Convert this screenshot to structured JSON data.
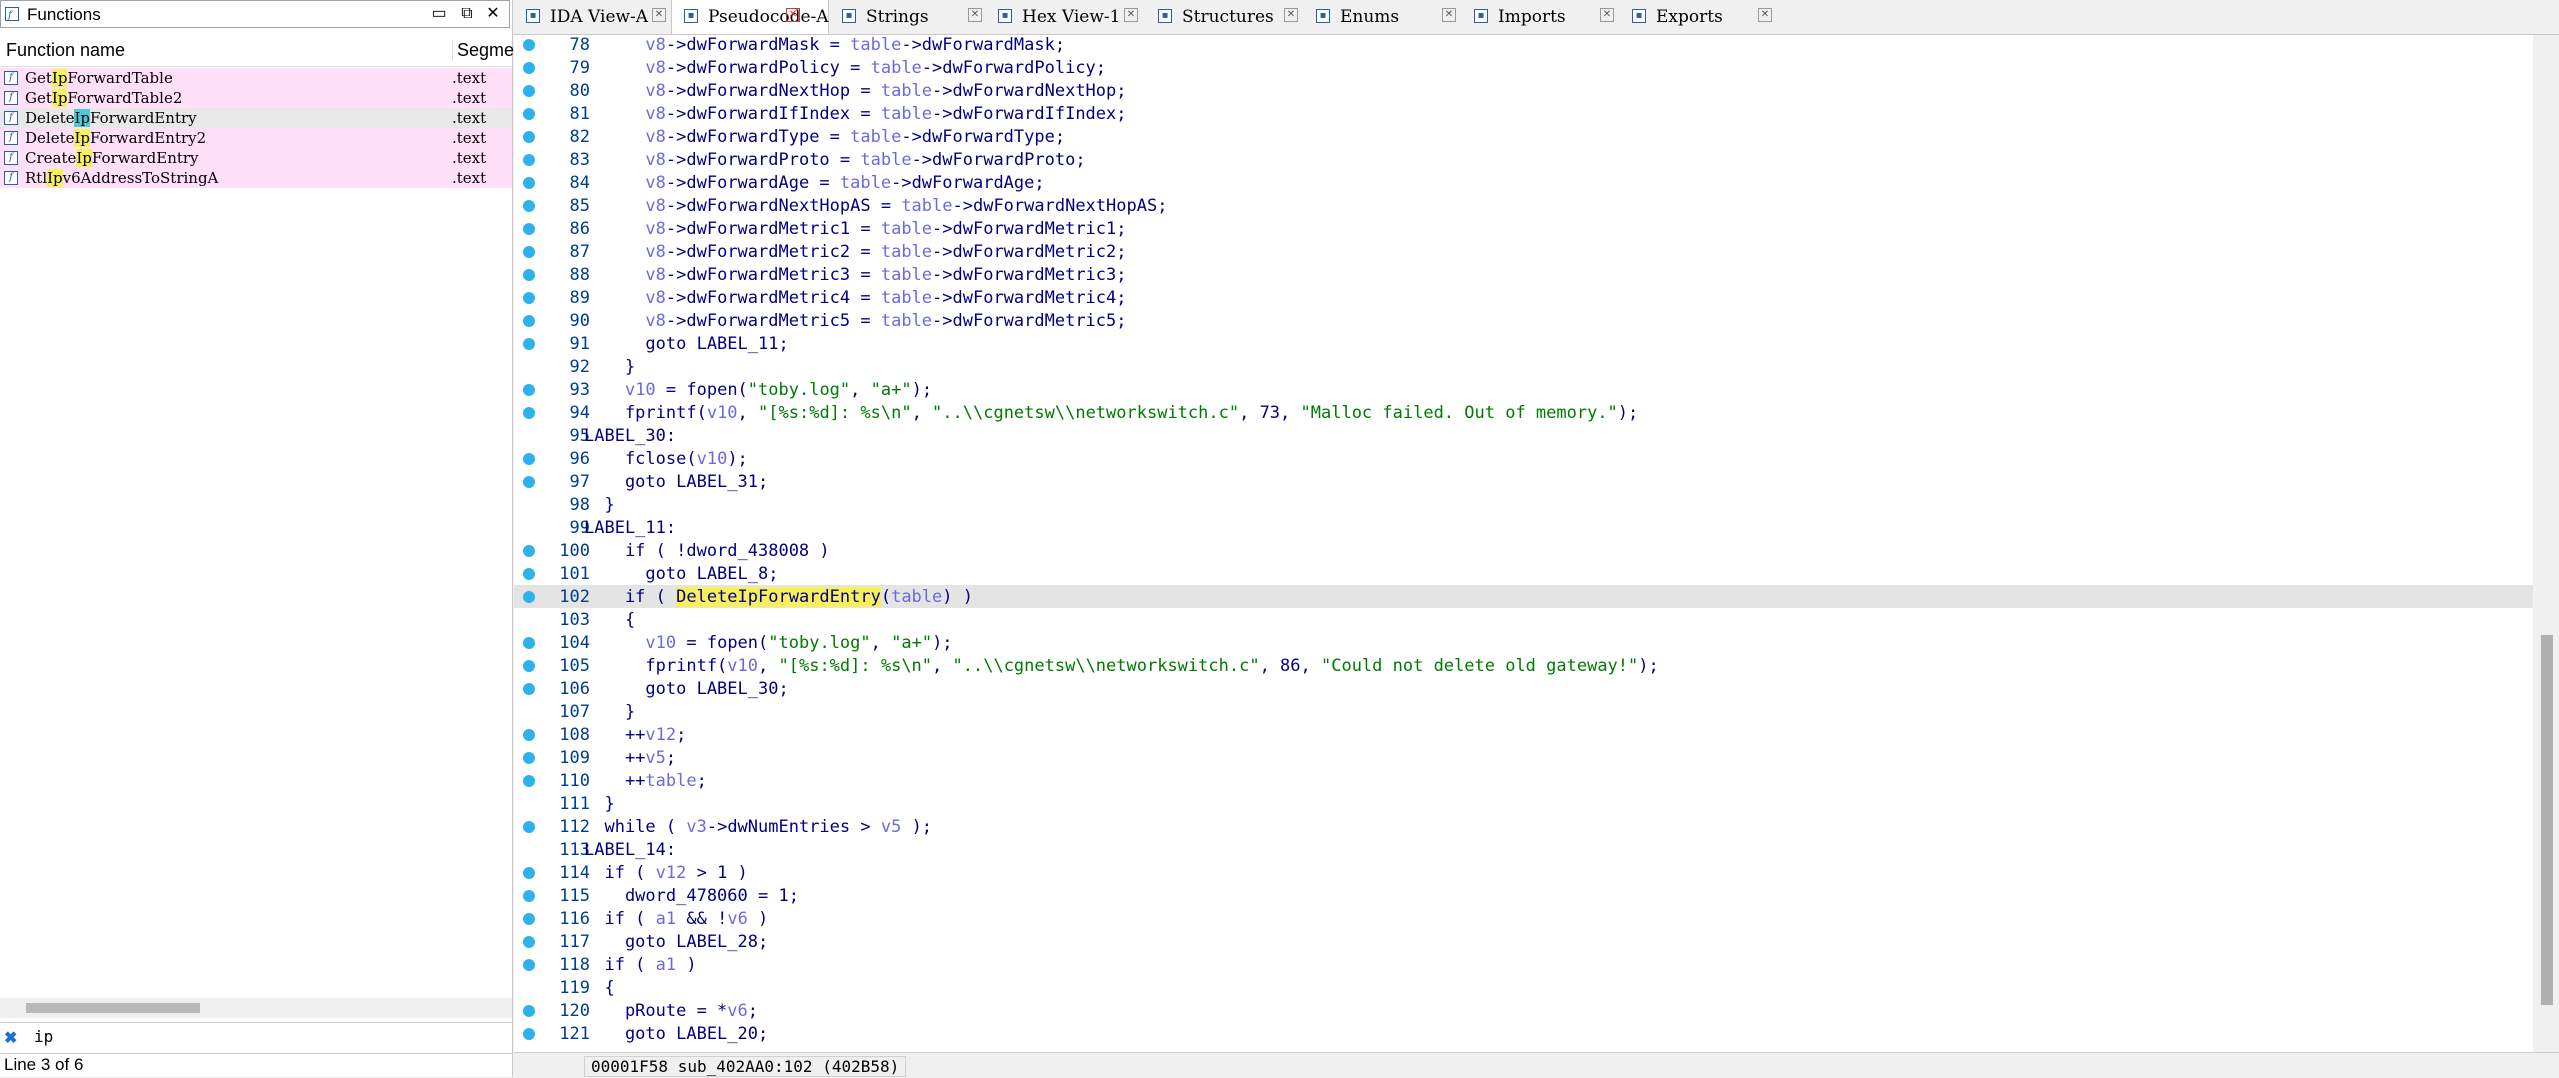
{
  "functions_pane": {
    "title": "Functions",
    "col_name": "Function name",
    "col_segment": "Segme",
    "rows": [
      {
        "pre": "Get",
        "hl": "Ip",
        "post": "ForwardTable",
        "seg": ".text",
        "selected": false
      },
      {
        "pre": "Get",
        "hl": "Ip",
        "post": "ForwardTable2",
        "seg": ".text",
        "selected": false
      },
      {
        "pre": "Delete",
        "hl": "Ip",
        "post": "ForwardEntry",
        "seg": ".text",
        "selected": true
      },
      {
        "pre": "Delete",
        "hl": "Ip",
        "post": "ForwardEntry2",
        "seg": ".text",
        "selected": false
      },
      {
        "pre": "Create",
        "hl": "Ip",
        "post": "ForwardEntry",
        "seg": ".text",
        "selected": false
      },
      {
        "pre": "Rtl",
        "hl": "Ip",
        "post": "v6AddressToStringA",
        "seg": ".text",
        "selected": false
      }
    ],
    "filter": "ip",
    "status": "Line 3 of 6"
  },
  "tabs": [
    {
      "label": "IDA View-A",
      "active": false
    },
    {
      "label": "Pseudocode-A",
      "active": true
    },
    {
      "label": "Strings",
      "active": false
    },
    {
      "label": "Hex View-1",
      "active": false
    },
    {
      "label": "Structures",
      "active": false
    },
    {
      "label": "Enums",
      "active": false
    },
    {
      "label": "Imports",
      "active": false
    },
    {
      "label": "Exports",
      "active": false
    }
  ],
  "code_lines": [
    {
      "n": "78",
      "dot": true,
      "html": "      <span class='v'>v8</span>-&gt;dwForwardMask = <span class='v'>table</span>-&gt;dwForwardMask;"
    },
    {
      "n": "79",
      "dot": true,
      "html": "      <span class='v'>v8</span>-&gt;dwForwardPolicy = <span class='v'>table</span>-&gt;dwForwardPolicy;"
    },
    {
      "n": "80",
      "dot": true,
      "html": "      <span class='v'>v8</span>-&gt;dwForwardNextHop = <span class='v'>table</span>-&gt;dwForwardNextHop;"
    },
    {
      "n": "81",
      "dot": true,
      "html": "      <span class='v'>v8</span>-&gt;dwForwardIfIndex = <span class='v'>table</span>-&gt;dwForwardIfIndex;"
    },
    {
      "n": "82",
      "dot": true,
      "html": "      <span class='v'>v8</span>-&gt;dwForwardType = <span class='v'>table</span>-&gt;dwForwardType;"
    },
    {
      "n": "83",
      "dot": true,
      "html": "      <span class='v'>v8</span>-&gt;dwForwardProto = <span class='v'>table</span>-&gt;dwForwardProto;"
    },
    {
      "n": "84",
      "dot": true,
      "html": "      <span class='v'>v8</span>-&gt;dwForwardAge = <span class='v'>table</span>-&gt;dwForwardAge;"
    },
    {
      "n": "85",
      "dot": true,
      "html": "      <span class='v'>v8</span>-&gt;dwForwardNextHopAS = <span class='v'>table</span>-&gt;dwForwardNextHopAS;"
    },
    {
      "n": "86",
      "dot": true,
      "html": "      <span class='v'>v8</span>-&gt;dwForwardMetric1 = <span class='v'>table</span>-&gt;dwForwardMetric1;"
    },
    {
      "n": "87",
      "dot": true,
      "html": "      <span class='v'>v8</span>-&gt;dwForwardMetric2 = <span class='v'>table</span>-&gt;dwForwardMetric2;"
    },
    {
      "n": "88",
      "dot": true,
      "html": "      <span class='v'>v8</span>-&gt;dwForwardMetric3 = <span class='v'>table</span>-&gt;dwForwardMetric3;"
    },
    {
      "n": "89",
      "dot": true,
      "html": "      <span class='v'>v8</span>-&gt;dwForwardMetric4 = <span class='v'>table</span>-&gt;dwForwardMetric4;"
    },
    {
      "n": "90",
      "dot": true,
      "html": "      <span class='v'>v8</span>-&gt;dwForwardMetric5 = <span class='v'>table</span>-&gt;dwForwardMetric5;"
    },
    {
      "n": "91",
      "dot": true,
      "html": "      goto LABEL_11;"
    },
    {
      "n": "92",
      "dot": false,
      "html": "    }"
    },
    {
      "n": "93",
      "dot": true,
      "html": "    <span class='v'>v10</span> = fopen(<span class='s'>\"toby.log\"</span>, <span class='s'>\"a+\"</span>);"
    },
    {
      "n": "94",
      "dot": true,
      "html": "    fprintf(<span class='v'>v10</span>, <span class='s'>\"[%s:%d]: %s\\n\"</span>, <span class='s'>\"..\\\\cgnetsw\\\\networkswitch.c\"</span>, 73, <span class='s'>\"Malloc failed. Out of memory.\"</span>);"
    },
    {
      "n": "95",
      "dot": false,
      "html": "LABEL_30:"
    },
    {
      "n": "96",
      "dot": true,
      "html": "    fclose(<span class='v'>v10</span>);"
    },
    {
      "n": "97",
      "dot": true,
      "html": "    goto LABEL_31;"
    },
    {
      "n": "98",
      "dot": false,
      "html": "  }"
    },
    {
      "n": "99",
      "dot": false,
      "html": "LABEL_11:"
    },
    {
      "n": "100",
      "dot": true,
      "html": "    if ( !dword_438008 )"
    },
    {
      "n": "101",
      "dot": true,
      "html": "      goto LABEL_8;"
    },
    {
      "n": "102",
      "dot": true,
      "cur": true,
      "html": "    if ( <span class='hlc'>DeleteIpForwardEntry</span>(<span class='v'>table</span>) )"
    },
    {
      "n": "103",
      "dot": false,
      "html": "    {"
    },
    {
      "n": "104",
      "dot": true,
      "html": "      <span class='v'>v10</span> = fopen(<span class='s'>\"toby.log\"</span>, <span class='s'>\"a+\"</span>);"
    },
    {
      "n": "105",
      "dot": true,
      "html": "      fprintf(<span class='v'>v10</span>, <span class='s'>\"[%s:%d]: %s\\n\"</span>, <span class='s'>\"..\\\\cgnetsw\\\\networkswitch.c\"</span>, 86, <span class='s'>\"Could not delete old gateway!\"</span>);"
    },
    {
      "n": "106",
      "dot": true,
      "html": "      goto LABEL_30;"
    },
    {
      "n": "107",
      "dot": false,
      "html": "    }"
    },
    {
      "n": "108",
      "dot": true,
      "html": "    ++<span class='v'>v12</span>;"
    },
    {
      "n": "109",
      "dot": true,
      "html": "    ++<span class='v'>v5</span>;"
    },
    {
      "n": "110",
      "dot": true,
      "html": "    ++<span class='v'>table</span>;"
    },
    {
      "n": "111",
      "dot": false,
      "html": "  }"
    },
    {
      "n": "112",
      "dot": true,
      "html": "  while ( <span class='v'>v3</span>-&gt;dwNumEntries &gt; <span class='v'>v5</span> );"
    },
    {
      "n": "113",
      "dot": false,
      "html": "LABEL_14:"
    },
    {
      "n": "114",
      "dot": true,
      "html": "  if ( <span class='v'>v12</span> &gt; 1 )"
    },
    {
      "n": "115",
      "dot": true,
      "html": "    dword_478060 = 1;"
    },
    {
      "n": "116",
      "dot": true,
      "html": "  if ( <span class='v'>a1</span> &amp;&amp; !<span class='v'>v6</span> )"
    },
    {
      "n": "117",
      "dot": true,
      "html": "    goto LABEL_28;"
    },
    {
      "n": "118",
      "dot": true,
      "html": "  if ( <span class='v'>a1</span> )"
    },
    {
      "n": "119",
      "dot": false,
      "html": "  {"
    },
    {
      "n": "120",
      "dot": true,
      "html": "    pRoute = *<span class='v'>v6</span>;"
    },
    {
      "n": "121",
      "dot": true,
      "html": "    goto LABEL_20;"
    }
  ],
  "status_bar": "00001F58 sub_402AA0:102 (402B58)"
}
